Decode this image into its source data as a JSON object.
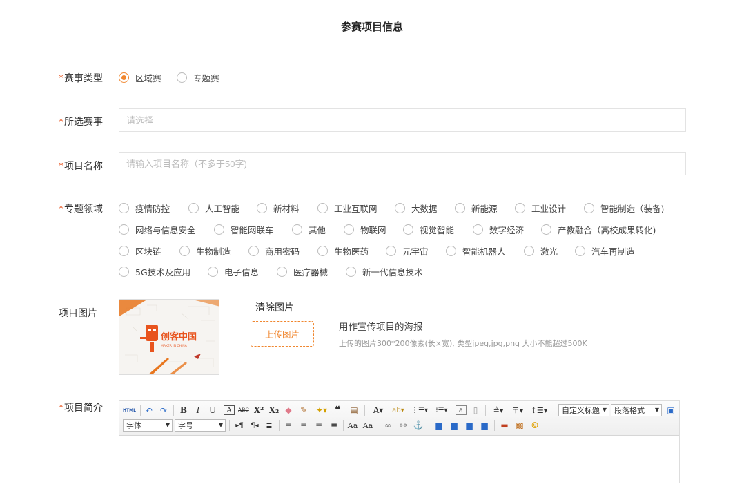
{
  "page_title": "参赛项目信息",
  "required_mark": "*",
  "fields": {
    "event_type": {
      "label": "赛事类型",
      "options": [
        "区域赛",
        "专题赛"
      ],
      "selected": "区域赛"
    },
    "event_select": {
      "label": "所选赛事",
      "placeholder": "请选择"
    },
    "project_name": {
      "label": "项目名称",
      "placeholder": "请输入项目名称（不多于50字)"
    },
    "domain": {
      "label": "专题领域",
      "options": [
        "疫情防控",
        "人工智能",
        "新材料",
        "工业互联网",
        "大数据",
        "新能源",
        "工业设计",
        "智能制造（装备)",
        "网络与信息安全",
        "智能网联车",
        "其他",
        "物联网",
        "视觉智能",
        "数字经济",
        "产教融合（高校成果转化)",
        "区块链",
        "生物制造",
        "商用密码",
        "生物医药",
        "元宇宙",
        "智能机器人",
        "激光",
        "汽车再制造",
        "5G技术及应用",
        "电子信息",
        "医疗器械",
        "新一代信息技术"
      ]
    },
    "image": {
      "label": "项目图片",
      "clear": "清除图片",
      "upload": "上传图片",
      "hint_title": "用作宣传项目的海报",
      "hint_detail": "上传的图片300*200像素(长×宽), 类型jpeg,jpg,png 大小不能超过500K",
      "logo_text": "创客中国",
      "logo_sub": "MAKER IN CHINA"
    },
    "intro": {
      "label": "项目简介",
      "toolbar": {
        "html": "HTML",
        "custom_title": "自定义标题",
        "paragraph_format": "段落格式",
        "font": "字体",
        "font_size": "字号"
      }
    }
  },
  "colors": {
    "accent": "#f0862e",
    "required": "#e8541e"
  }
}
